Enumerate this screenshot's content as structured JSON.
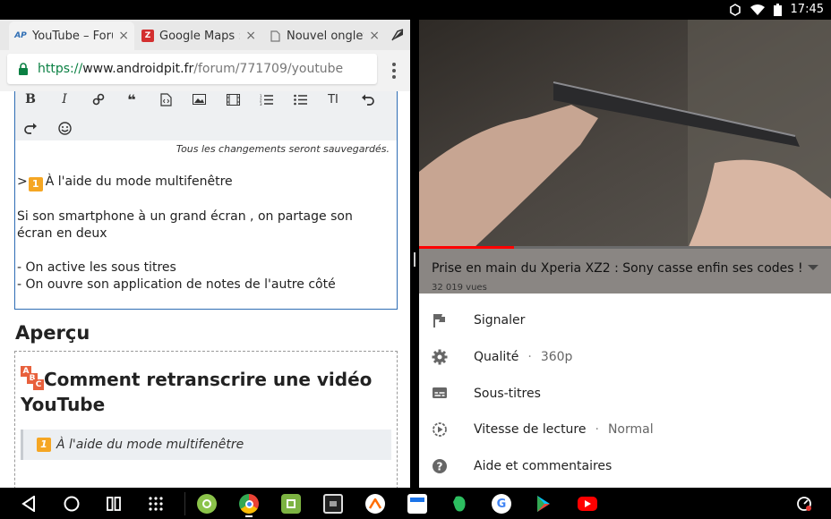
{
  "status_bar": {
    "time": "17:45"
  },
  "browser": {
    "tabs": [
      {
        "favicon_text": "AP",
        "title": "YouTube – Forum",
        "close": "×"
      },
      {
        "favicon_text": "Z",
        "title": "Google Maps : l'A",
        "close": "×"
      },
      {
        "favicon_text": "",
        "title": "Nouvel onglet",
        "close": "×"
      }
    ],
    "url": {
      "scheme": "https://",
      "host": "www.androidpit.fr",
      "path": "/forum/771709/youtube"
    }
  },
  "editor": {
    "toolbar_buttons": [
      "bold",
      "italic",
      "link",
      "quote",
      "code",
      "image",
      "video",
      "ordered-list",
      "unordered-list",
      "text-size",
      "undo",
      "redo",
      "emoji"
    ],
    "bold_label": "B",
    "italic_label": "I",
    "quote_label": "❝",
    "textsize_label": "TI",
    "saved_note": "Tous les changements seront sauvegardés.",
    "line1_prefix": ">",
    "line1_emoji": "1",
    "line1_text": "À l'aide du mode multifenêtre",
    "paragraph": "Si son smartphone à un grand écran , on partage son écran en deux",
    "bullet1": "- On active les sous titres",
    "bullet2": "- On ouvre son application de notes de l'autre côté"
  },
  "preview": {
    "heading": "Aperçu",
    "abc": [
      "A",
      "B",
      "C"
    ],
    "title": "Comment retranscrire une vidéo YouTube",
    "quote_emoji": "1",
    "quote_text": "À l'aide du mode multifenêtre"
  },
  "youtube": {
    "progress": 0.23,
    "video_title": "Prise en main du Xperia XZ2 : Sony casse enfin ses codes !",
    "views": "32 019 vues",
    "options": [
      {
        "icon": "flag-icon",
        "label": "Signaler",
        "value": ""
      },
      {
        "icon": "gear-icon",
        "label": "Qualité",
        "value": "360p"
      },
      {
        "icon": "subtitles-icon",
        "label": "Sous-titres",
        "value": ""
      },
      {
        "icon": "playback-speed-icon",
        "label": "Vitesse de lecture",
        "value": "Normal"
      },
      {
        "icon": "help-icon",
        "label": "Aide et commentaires",
        "value": ""
      }
    ]
  },
  "nav": {
    "apps": [
      "settings-gear",
      "chrome",
      "green-app",
      "screen-app",
      "aliexpress",
      "calendar",
      "evernote",
      "google",
      "play-store",
      "youtube"
    ]
  },
  "colors": {
    "accent_blue": "#2e6db4",
    "youtube_red": "#ff0000",
    "secure_green": "#0b8043"
  }
}
